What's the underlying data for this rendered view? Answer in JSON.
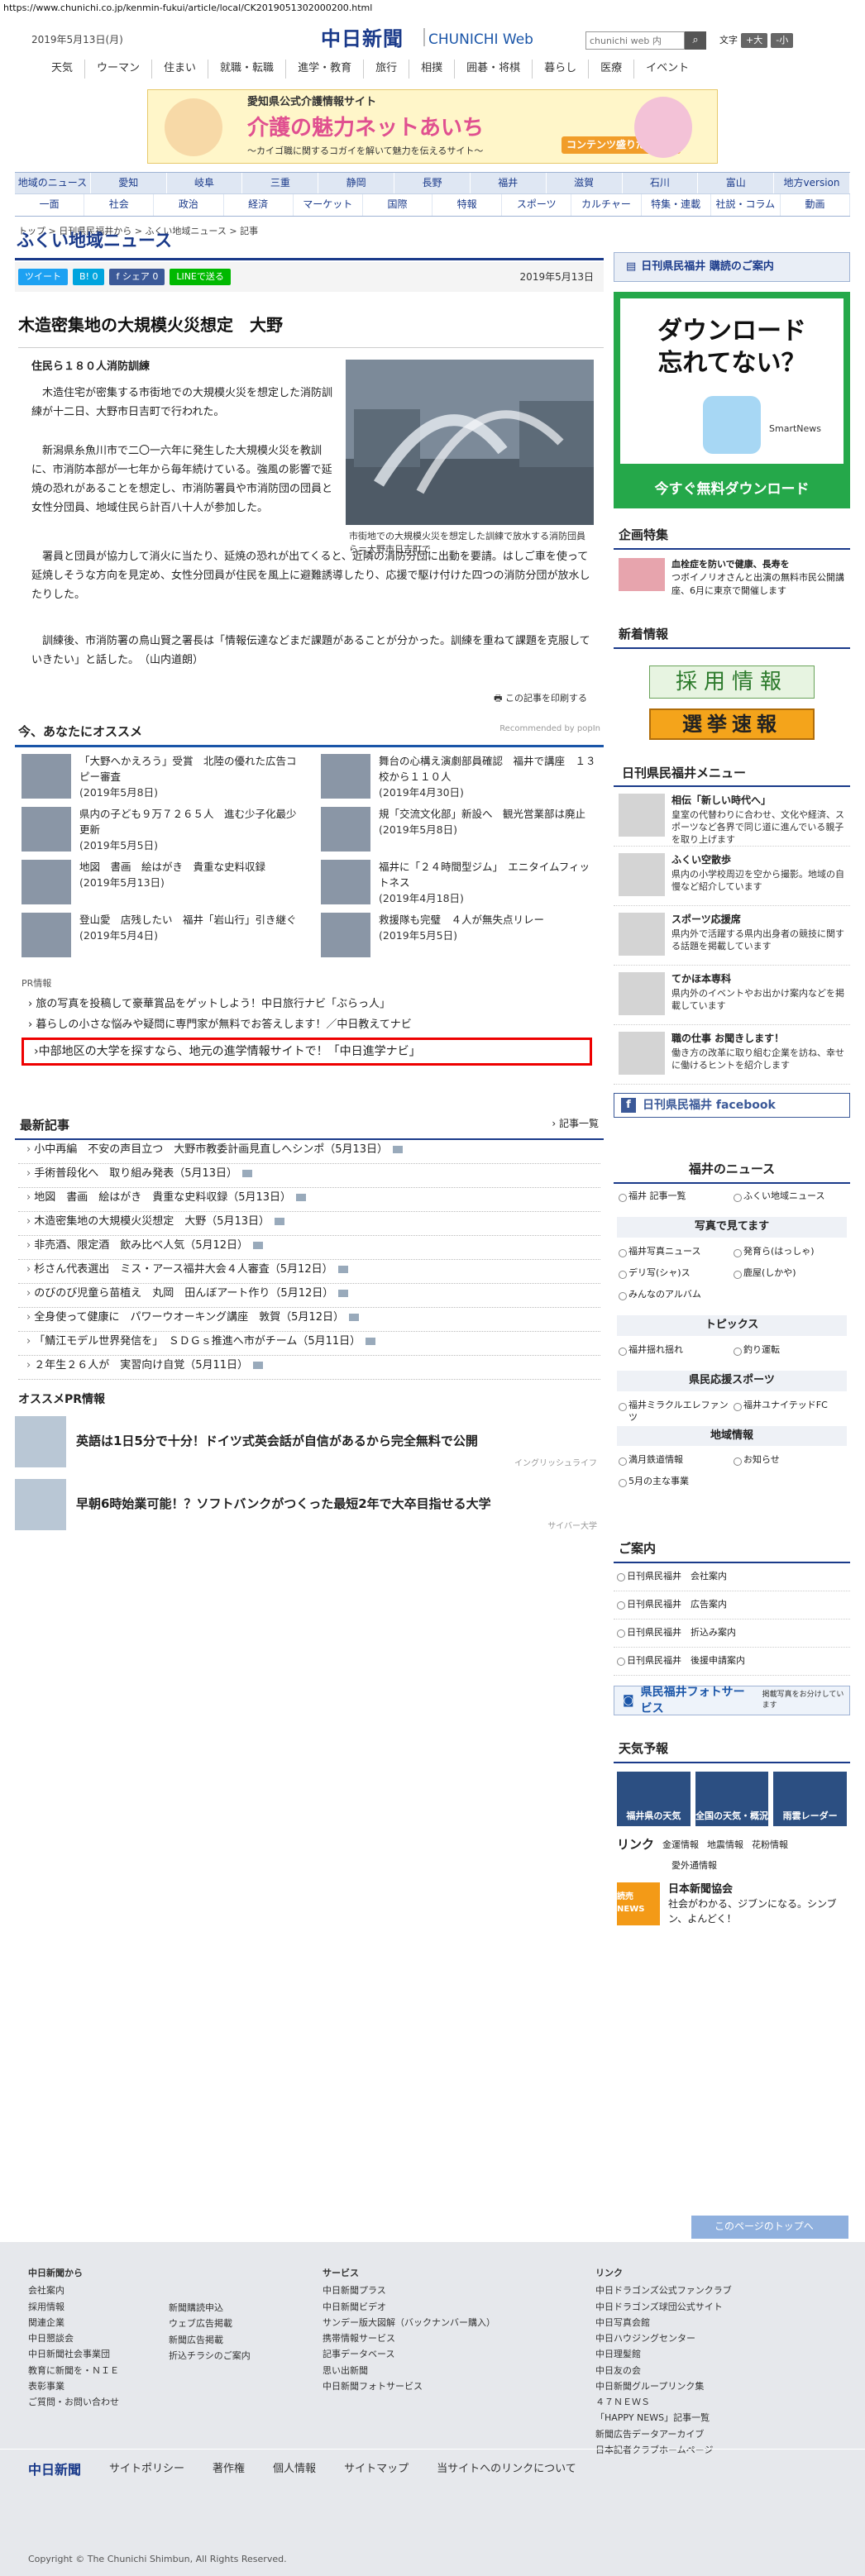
{
  "browser": {
    "url": "https://www.chunichi.co.jp/kenmin-fukui/article/local/CK2019051302000200.html"
  },
  "header": {
    "date": "2019年5月13日(月)",
    "logo_jp": "中日新聞",
    "logo_en": "CHUNICHI Web",
    "search_placeholder": "chunichi web 内",
    "font_label": "文字",
    "font_large": "+大",
    "font_small": "-小",
    "nav": [
      "天気",
      "ウーマン",
      "住まい",
      "就職・転職",
      "進学・教育",
      "旅行",
      "相撲",
      "囲碁・将棋",
      "暮らし",
      "医療",
      "イベント"
    ]
  },
  "banner": {
    "line1": "愛知県公式介護情報サイト",
    "line2": "介護の魅力ネットあいち",
    "line3": "～カイゴ職に関するコガイを解いて魅力を伝えるサイト～",
    "badge": "コンテンツ盛りだくさん"
  },
  "sections": {
    "row1": [
      "地域のニュース",
      "愛知",
      "岐阜",
      "三重",
      "静岡",
      "長野",
      "福井",
      "滋賀",
      "石川",
      "富山",
      "地方version"
    ],
    "row2": [
      "一面",
      "社会",
      "政治",
      "経済",
      "マーケット",
      "国際",
      "特報",
      "スポーツ",
      "カルチャー",
      "特集・連載",
      "社説・コラム",
      "動画"
    ]
  },
  "breadcrumb": "トップ > 日刊県民福井から > ふくい地域ニュース > 記事",
  "page_title": "ふくい地域ニュース",
  "share": {
    "tweet": "ツイート",
    "b": "B! 0",
    "fb": "f シェア 0",
    "line": "LINEで送る",
    "date": "2019年5月13日"
  },
  "article": {
    "title": "木造密集地の大規模火災想定　大野",
    "lead": "住民ら１８０人消防訓練",
    "p1": "　木造住宅が密集する市街地での大規模火災を想定した消防訓練が十二日、大野市日吉町で行われた。",
    "p2": "　新潟県糸魚川市で二〇一六年に発生した大規模火災を教訓に、市消防本部が一七年から毎年続けている。強風の影響で延焼の恐れがあることを想定し、市消防署員や市消防団の団員と女性分団員、地域住民ら計百八十人が参加した。",
    "p3": "　署員と団員が協力して消火に当たり、延焼の恐れが出てくると、近隣の消防分団に出動を要請。はしご車を使って延焼しそうな方向を見定め、女性分団員が住民を風上に避難誘導したり、応援で駆け付けた四つの消防分団が放水したりした。",
    "p4": "　訓練後、市消防署の鳥山賢之署長は「情報伝達などまだ課題があることが分かった。訓練を重ねて課題を克服していきたい」と話した。　（山内道朗）",
    "caption": "市街地での大規模火災を想定した訓練で放水する消防団員ら＝大野市日吉町で",
    "print": "この記事を印刷する"
  },
  "osusume": {
    "title": "今、あなたにオススメ",
    "recommended": "Recommended by popIn",
    "items": [
      {
        "t": "「大野へかえろう」受賞　北陸の優れた広告コピー審査",
        "d": "(2019年5月8日)"
      },
      {
        "t": "舞台の心構え演劇部員確認　福井で講座　１３校から１１０人",
        "d": "(2019年4月30日)"
      },
      {
        "t": "県内の子ども９万７２６５人　進む少子化最少更新",
        "d": "(2019年5月5日)"
      },
      {
        "t": "規「交流文化部」新設へ　観光営業部は廃止",
        "d": "(2019年5月8日)"
      },
      {
        "t": "地図　書画　絵はがき　貴重な史料収録",
        "d": "(2019年5月13日)"
      },
      {
        "t": "福井に「２４時間型ジム」　エニタイムフィットネス",
        "d": "(2019年4月18日)"
      },
      {
        "t": "登山愛　店残したい　福井「岩山行」引き継ぐ",
        "d": "(2019年5月4日)"
      },
      {
        "t": "救援隊も完璧　４人が無失点リレー",
        "d": "(2019年5月5日)"
      }
    ]
  },
  "pr": {
    "label": "PR情報",
    "items": [
      "旅の写真を投稿して豪華賞品をゲットしよう！中日旅行ナビ「ぶらっ人」",
      "暮らしの小さな悩みや疑問に専門家が無料でお答えします！／中日教えてナビ"
    ],
    "highlight": "中部地区の大学を探すなら、地元の進学情報サイトで！「中日進学ナビ」"
  },
  "latest": {
    "title": "最新記事",
    "more": "記事一覧",
    "items": [
      "小中再編　不安の声目立つ　大野市教委計画見直しへシンポ（5月13日）",
      "手術普段化へ　取り組み発表（5月13日）",
      "地図　書画　絵はがき　貴重な史料収録（5月13日）",
      "木造密集地の大規模火災想定　大野（5月13日）",
      "非売酒、限定酒　飲み比べ人気（5月12日）",
      "杉さん代表選出　ミス・アース福井大会４人審査（5月12日）",
      "のびのび児童ら苗植え　丸岡　田んぼアート作り（5月12日）",
      "全身使って健康に　パワーウオーキング講座　敦賀（5月12日）",
      "「鯖江モデル世界発信を」　ＳＤＧｓ推進へ市がチーム（5月11日）",
      "２年生２６人が　実習向け自覚（5月11日）"
    ]
  },
  "prinfo": {
    "title": "オススメPR情報",
    "items": [
      {
        "t": "英語は1日5分で十分！ドイツ式英会話が自信があるから完全無料で公開",
        "s": "イングリッシュライフ"
      },
      {
        "t": "早朝6時始業可能！？ソフトバンクがつくった最短2年で大卒目指せる大学",
        "s": "サイバー大学"
      }
    ]
  },
  "sidebar": {
    "subscribe": "日刊県民福井 購読のご案内",
    "dl_big1": "ダウンロード",
    "dl_big2": "忘れてない？",
    "dl_app": "SmartNews",
    "dl_cta": "今すぐ無料ダウンロード",
    "kikaku_title": "企画特集",
    "kikaku_t": "血栓症を防いで健康、長寿を",
    "kikaku_d": "つボイノリオさんと出演の無料市民公開講座、6月に東京で開催します",
    "shinchaku": "新着情報",
    "saiyo": "採用情報",
    "senkyo": "選挙速報",
    "menu_title": "日刊県民福井メニュー",
    "menu": [
      {
        "t": "相伝「新しい時代へ」",
        "d": "皇室の代替わりに合わせ、文化や経済、スポーツなど各界で同じ道に進んでいる親子を取り上げます"
      },
      {
        "t": "ふくい空散歩",
        "d": "県内の小学校周辺を空から撮影。地域の自慢など紹介しています"
      },
      {
        "t": "スポーツ応援席",
        "d": "県内外で活躍する県内出身者の競技に関する話題を掲載しています"
      },
      {
        "t": "てかほ本専科",
        "d": "県内外のイベントやお出かけ案内などを掲載しています"
      },
      {
        "t": "職の仕事 お聞きします！",
        "d": "働き方の改革に取り組む企業を訪ね、幸せに働けるヒントを紹介します"
      }
    ],
    "facebook": "日刊県民福井 facebook",
    "fukui_title": "福井のニュース",
    "fukui_g1": [
      "福井 記事一覧",
      "ふくい地域ニュース"
    ],
    "photo_title": "写真で見てます",
    "fukui_g2": [
      "福井写真ニュース",
      "発育ら(はっしゃ)",
      "デリ写(シャ)ス",
      "鹿屋(しかや)",
      "みんなのアルバム"
    ],
    "topics_title": "トピックス",
    "fukui_g3": [
      "福井揺れ揺れ",
      "釣り運転"
    ],
    "sports_title": "県民応援スポーツ",
    "fukui_g4": [
      "福井ミラクルエレファンツ",
      "福井ユナイテッドFC"
    ],
    "region_title": "地域情報",
    "fukui_g5": [
      "満月鉄道情報",
      "お知らせ",
      "5月の主な事業"
    ],
    "annai_title": "ご案内",
    "annai": [
      "日刊県民福井　会社案内",
      "日刊県民福井　広告案内",
      "日刊県民福井　折込み案内",
      "日刊県民福井　後援申請案内"
    ],
    "photosvc": "県民福井フォトサービス",
    "photosvc_sub": "掲載写真をお分けしています",
    "tenki_title": "天気予報",
    "tenki": [
      "福井県の天気",
      "全国の天気・概況",
      "雨雲レーダー"
    ],
    "link_title": "リンク",
    "links": [
      "金運情報",
      "地震情報",
      "花粉情報",
      "愛外通情報"
    ],
    "nihon_t": "日本新聞協会",
    "nihon_d": "社会がわかる、ジブンになる。シンブン、よんどく！",
    "nihon_th": "読売NEWS"
  },
  "footer": {
    "pagetop": "このページのトップへ",
    "col1h": "中日新聞から",
    "col1": [
      "会社案内",
      "採用情報",
      "関連企業",
      "中日懇談会",
      "中日新聞社会事業団",
      "教育に新聞を・ＮＩＥ",
      "表彰事業",
      "ご質問・お問い合わせ"
    ],
    "col2": [
      "新聞購読申込",
      "ウェブ広告掲載",
      "新聞広告掲載",
      "折込チラシのご案内"
    ],
    "col3h": "サービス",
    "col3": [
      "中日新聞プラス",
      "中日新聞ビデオ",
      "サンデー版大図解（バックナンバー購入）",
      "携帯情報サービス",
      "記事データベース",
      "思い出新聞",
      "中日新聞フォトサービス"
    ],
    "col4h": "リンク",
    "col4": [
      "中日ドラゴンズ公式ファンクラブ",
      "中日ドラゴンズ球団公式サイト",
      "中日写真会館",
      "中日ハウジングセンター",
      "中日理髪館",
      "中日友の会",
      "中日新聞グループリンク集",
      "４７ＮＥＷＳ",
      "「HAPPY NEWS」記事一覧",
      "新聞広告データアーカイブ",
      "日本記者クラブホームページ"
    ],
    "bar": [
      "中日新聞",
      "サイトポリシー",
      "著作権",
      "個人情報",
      "サイトマップ",
      "当サイトへのリンクについて"
    ],
    "copy": "Copyright © The Chunichi Shimbun, All Rights Reserved."
  }
}
